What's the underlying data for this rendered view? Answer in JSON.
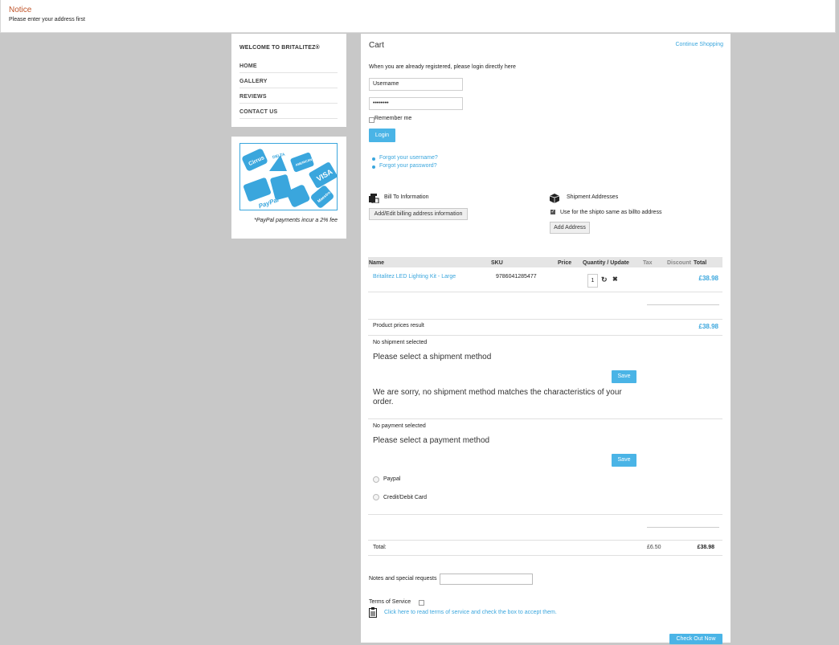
{
  "notice": {
    "title": "Notice",
    "message": "Please enter your address first"
  },
  "sidebar": {
    "welcome": "WELCOME TO BRITALITEZ®",
    "items": [
      {
        "label": "HOME"
      },
      {
        "label": "GALLERY"
      },
      {
        "label": "REVIEWS"
      },
      {
        "label": "CONTACT US"
      }
    ],
    "payment_logos": {
      "labels": [
        "Cirrus",
        "DELTA",
        "AMERICAN EXPRESS",
        "VISA",
        "PayPal",
        "Maestro"
      ],
      "note": "*PayPal payments incur a 2% fee"
    }
  },
  "cart": {
    "title": "Cart",
    "continue_shopping": "Continue Shopping",
    "login_intro": "When you are already registered, please login directly here",
    "username_placeholder": "Username",
    "password_value": "••••••••",
    "remember_label": "Remember me",
    "login_button": "Login",
    "forgot_username": "Forgot your username?",
    "forgot_password": "Forgot your password?"
  },
  "billing": {
    "heading": "Bill To Information",
    "button": "Add/Edit billing address information"
  },
  "shipping": {
    "heading": "Shipment Addresses",
    "same_as_bill": "Use for the shipto same as billto address",
    "same_checked": true,
    "button": "Add Address"
  },
  "table": {
    "headers": {
      "name": "Name",
      "sku": "SKU",
      "price": "Price",
      "qty": "Quantity / Update",
      "tax": "Tax",
      "discount": "Discount",
      "total": "Total"
    },
    "rows": [
      {
        "name": "Britalitez LED Lighting Kit - Large",
        "sku": "9786041285477",
        "qty": "1",
        "total": "£38.98"
      }
    ],
    "product_prices_label": "Product prices result",
    "product_prices_total": "£38.98"
  },
  "shipment": {
    "status": "No shipment selected",
    "prompt": "Please select a shipment method",
    "save": "Save",
    "sorry": "We are sorry, no shipment method matches the characteristics of your order."
  },
  "payment": {
    "status": "No payment selected",
    "prompt": "Please select a payment method",
    "save": "Save",
    "options": [
      {
        "label": "Paypal"
      },
      {
        "label": "Credit/Debit Card"
      }
    ]
  },
  "totals": {
    "label": "Total:",
    "tax": "£6.50",
    "total": "£38.98"
  },
  "notes": {
    "label": "Notes and special requests"
  },
  "tos": {
    "label": "Terms of Service",
    "link": "Click here to read terms of service and check the box to accept them."
  },
  "checkout_button": "Check Out Now"
}
